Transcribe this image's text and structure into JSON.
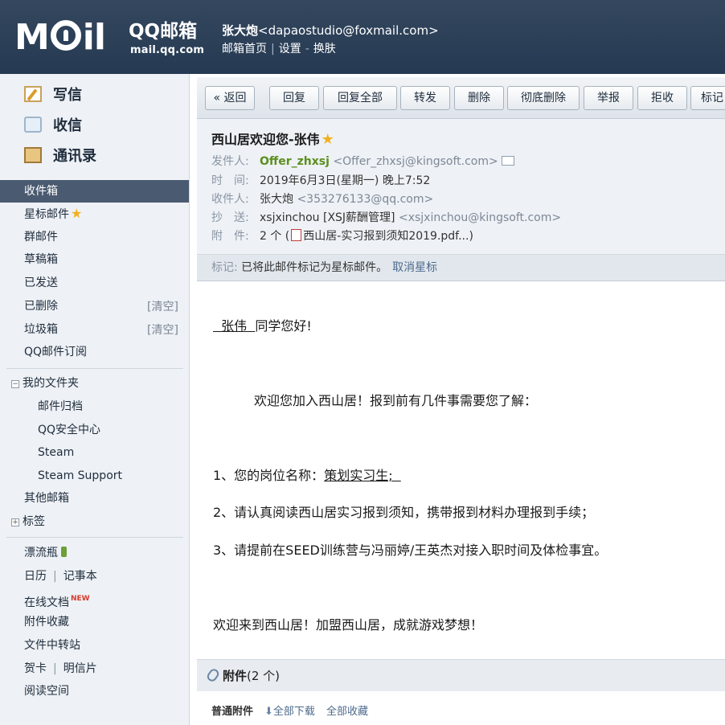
{
  "header": {
    "logo_text": "MOil",
    "logo_qq": "QQ邮箱",
    "logo_url": "mail.qq.com",
    "user_name": "张大炮",
    "user_email": "<dapaostudio@foxmail.com>",
    "links": [
      "邮箱首页",
      "设置",
      "换肤"
    ]
  },
  "sidebar": {
    "quick": [
      {
        "label": "写信",
        "icon": "write-icon"
      },
      {
        "label": "收信",
        "icon": "inbox-icon"
      },
      {
        "label": "通讯录",
        "icon": "contacts-icon"
      }
    ],
    "folders": [
      {
        "label": "收件箱",
        "active": true
      },
      {
        "label": "星标邮件"
      },
      {
        "label": "群邮件"
      },
      {
        "label": "草稿箱"
      },
      {
        "label": "已发送"
      },
      {
        "label": "已删除",
        "action": "[清空]"
      },
      {
        "label": "垃圾箱",
        "action": "[清空]"
      },
      {
        "label": "QQ邮件订阅"
      }
    ],
    "my_folders": {
      "toggle": "−",
      "title": "我的文件夹",
      "items": [
        "邮件归档",
        "QQ安全中心",
        "Steam",
        "Steam Support"
      ]
    },
    "other_mailbox": "其他邮箱",
    "tags": {
      "toggle": "+",
      "title": "标签"
    },
    "apps": [
      {
        "label": "漂流瓶"
      },
      {
        "label": "日历",
        "label2": "记事本"
      },
      {
        "label": "在线文档",
        "badge": "NEW"
      },
      {
        "label": "附件收藏"
      },
      {
        "label": "文件中转站"
      },
      {
        "label": "贺卡",
        "label2": "明信片"
      },
      {
        "label": "阅读空间"
      }
    ]
  },
  "toolbar": {
    "buttons": [
      "« 返回",
      "回复",
      "回复全部",
      "转发",
      "删除",
      "彻底删除",
      "举报",
      "拒收",
      "标记"
    ]
  },
  "message": {
    "subject": "西山居欢迎您-张伟",
    "sender_label": "发件人:",
    "sender_name": "Offer_zhxsj",
    "sender_email": "<Offer_zhxsj@kingsoft.com>",
    "time_label": "时　间:",
    "time": "2019年6月3日(星期一) 晚上7:52",
    "to_label": "收件人:",
    "to": "张大炮",
    "to_email": "<353276133@qq.com>",
    "cc_label": "抄　送:",
    "cc": "xsjxinchou [XSJ薪酬管理]",
    "cc_email": "<xsjxinchou@kingsoft.com>",
    "att_label": "附　件:",
    "att_count": "2 个 (",
    "att_file": "西山居-实习报到须知2019.pdf...)",
    "mark_label": "标记:",
    "mark_text": "已将此邮件标记为星标邮件。",
    "mark_link": "取消星标"
  },
  "body": {
    "greeting_name": "  张伟  ",
    "greeting_rest": "同学您好!",
    "intro": "欢迎您加入西山居！报到前有几件事需要您了解：",
    "item1_prefix": "1、您的岗位名称：",
    "item1_value": "策划实习生;  ",
    "item2": "2、请认真阅读西山居实习报到须知，携带报到材料办理报到手续；",
    "item3": "3、请提前在SEED训练营与冯丽婷/王英杰对接入职时间及体检事宜。",
    "closing": "欢迎来到西山居！加盟西山居，成就游戏梦想！"
  },
  "attachments": {
    "title": "附件",
    "count": "(2 个)",
    "normal_label": "普通附件",
    "download_all": "全部下载",
    "save_all": "全部收藏"
  },
  "colors": {
    "header_bg": "#2c3e55",
    "active_folder_bg": "#4a5a70",
    "sender_green": "#5b8f1e",
    "star": "#f2b01e"
  }
}
